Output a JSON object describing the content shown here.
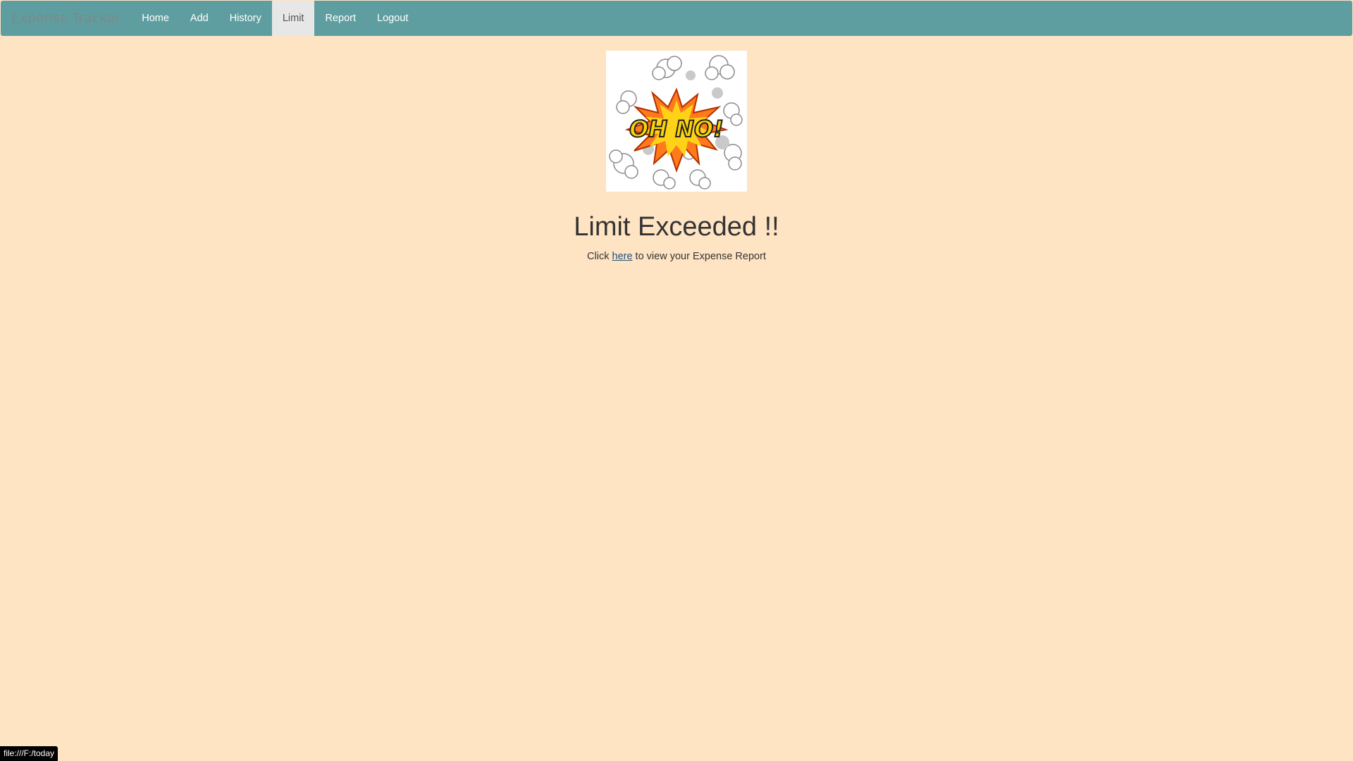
{
  "navbar": {
    "brand": "Expense Tracker",
    "items": [
      {
        "label": "Home",
        "active": false
      },
      {
        "label": "Add",
        "active": false
      },
      {
        "label": "History",
        "active": false
      },
      {
        "label": "Limit",
        "active": true
      },
      {
        "label": "Report",
        "active": false
      },
      {
        "label": "Logout",
        "active": false
      }
    ]
  },
  "main": {
    "image_text": "OH NO!",
    "heading": "Limit Exceeded !!",
    "message_prefix": "Click ",
    "link_text": "here",
    "message_suffix": " to view your Expense Report"
  },
  "status_bar": {
    "url": "file:///F:/today"
  },
  "colors": {
    "page_background": "#ffe4c4",
    "navbar_background": "#5f9ea0",
    "active_tab_background": "#e7e7e7"
  }
}
